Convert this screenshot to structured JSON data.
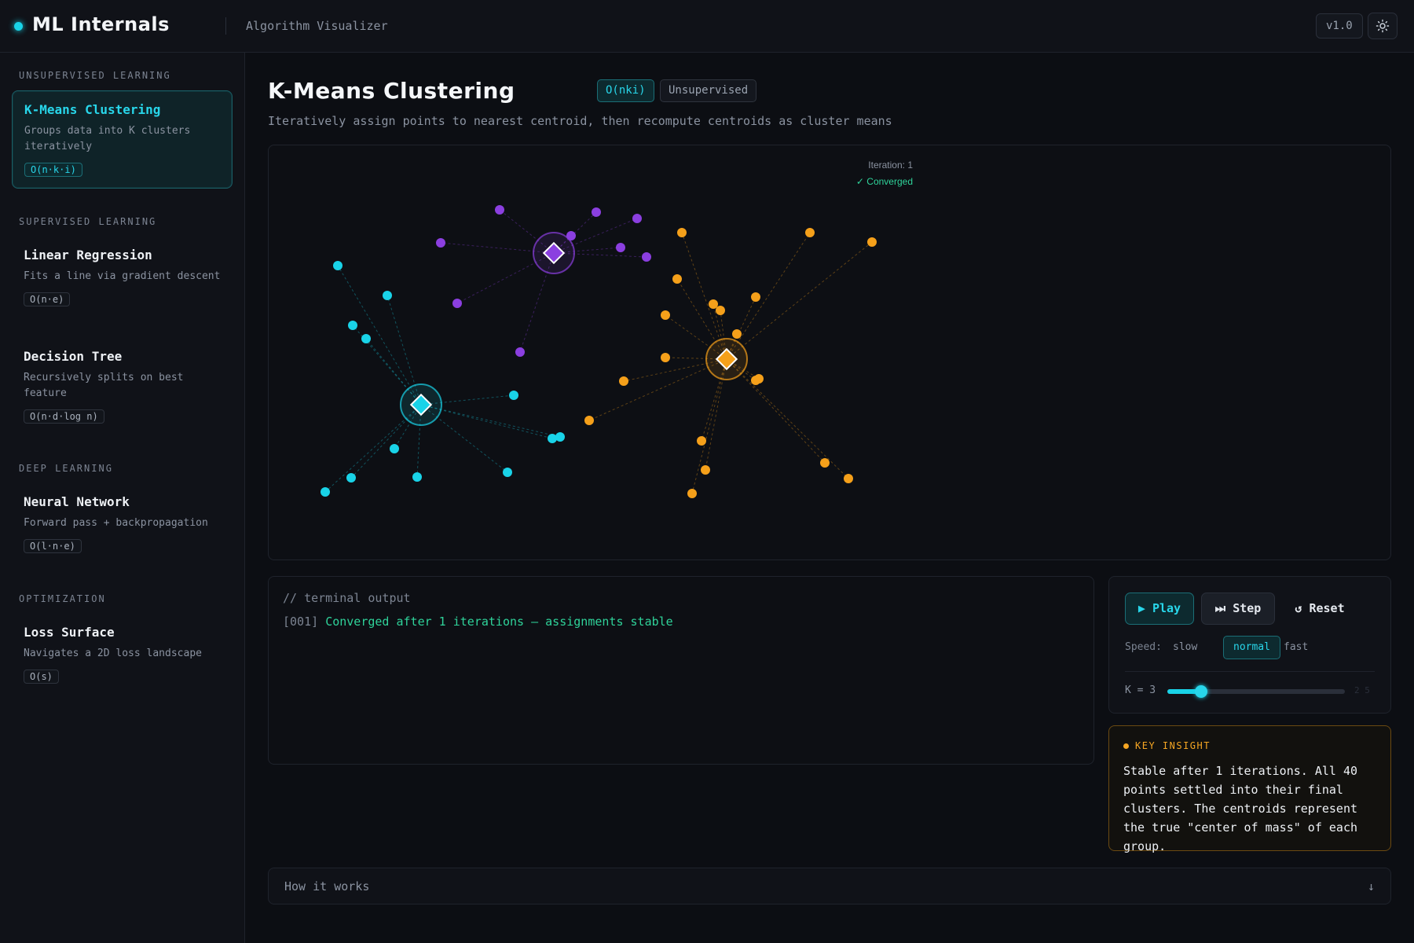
{
  "header": {
    "brand": "ML Internals",
    "subtitle": "Algorithm Visualizer",
    "version": "v1.0",
    "theme_icon": "sun-icon"
  },
  "sidebar": {
    "sections": [
      {
        "label": "UNSUPERVISED LEARNING"
      },
      {
        "label": "SUPERVISED LEARNING"
      },
      {
        "label": "DEEP LEARNING"
      },
      {
        "label": "OPTIMIZATION"
      }
    ],
    "items": [
      {
        "name": "K-Means Clustering",
        "desc": "Groups data into K clusters iteratively",
        "badge": "O(n·k·i)"
      },
      {
        "name": "Linear Regression",
        "desc": "Fits a line via gradient descent",
        "badge": "O(n·e)"
      },
      {
        "name": "Decision Tree",
        "desc": "Recursively splits on best feature",
        "badge": "O(n·d·log n)"
      },
      {
        "name": "Neural Network",
        "desc": "Forward pass + backpropagation",
        "badge": "O(l·n·e)"
      },
      {
        "name": "Loss Surface",
        "desc": "Navigates a 2D loss landscape",
        "badge": "O(s)"
      }
    ]
  },
  "main": {
    "title": "K-Means Clustering",
    "complexity": "O(nki)",
    "tag": "Unsupervised",
    "description": "Iteratively assign points to nearest centroid, then recompute centroids as cluster means",
    "canvas": {
      "iteration_label": "Iteration: 1",
      "status": "✓ Converged",
      "colors": {
        "cyan": "#19d3e8",
        "purple": "#8b3fe0",
        "orange": "#f5a01a"
      }
    },
    "terminal": {
      "header": "// terminal output",
      "lines": [
        {
          "idx": "[001]",
          "msg": "Converged after 1 iterations — assignments stable"
        }
      ]
    },
    "controls": {
      "play": "▶ Play",
      "step": "⏭ Step",
      "reset": "↺ Reset",
      "speed_label": "Speed:",
      "speeds": [
        "slow",
        "normal",
        "fast"
      ],
      "speed_selected": "normal",
      "k_label": "K = 3",
      "k_value": 3,
      "k_range": "2  5"
    },
    "insight": {
      "title": "KEY INSIGHT",
      "body": "Stable after 1 iterations. All 40 points settled into their final clusters. The centroids represent the true \"center of mass\" of each group."
    },
    "how_it_works": {
      "label": "How it works",
      "arrow": "↓"
    }
  }
}
